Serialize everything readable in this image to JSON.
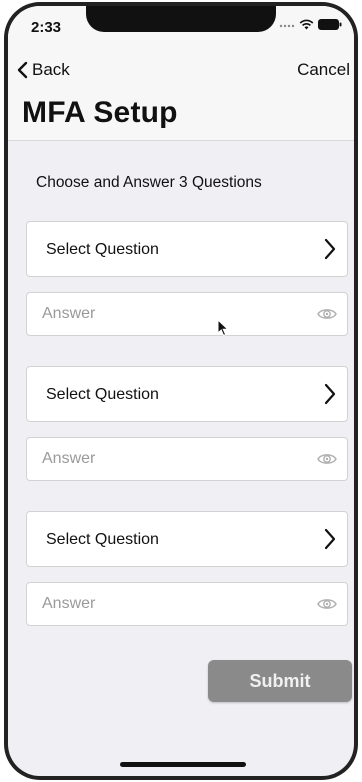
{
  "status_bar": {
    "time": "2:33",
    "icons": [
      "signal-dots-icon",
      "wifi-icon",
      "battery-icon"
    ]
  },
  "nav": {
    "back_label": "Back",
    "cancel_label": "Cancel"
  },
  "page": {
    "title": "MFA Setup",
    "instruction": "Choose and Answer 3 Questions"
  },
  "questions": [
    {
      "select_label": "Select Question",
      "answer_placeholder": "Answer",
      "answer_value": ""
    },
    {
      "select_label": "Select Question",
      "answer_placeholder": "Answer",
      "answer_value": ""
    },
    {
      "select_label": "Select Question",
      "answer_placeholder": "Answer",
      "answer_value": ""
    }
  ],
  "submit": {
    "label": "Submit",
    "color": "#8a8a8a"
  }
}
